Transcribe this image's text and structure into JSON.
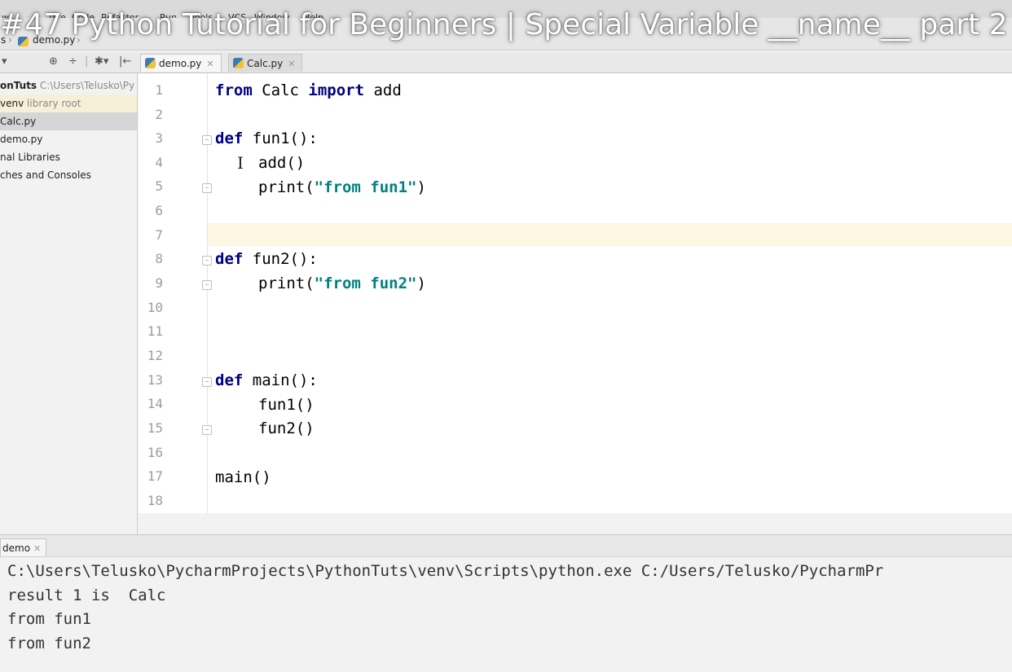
{
  "video_title": "#47 Python Tutorial for Beginners | Special Variable __name__ part 2",
  "menubar": {
    "items": [
      "w",
      "late",
      "Code",
      "Refactor",
      "Run",
      "Tools",
      "VCS",
      "Window",
      "Help"
    ]
  },
  "breadcrumb": {
    "folder": "s",
    "file": "demo.py"
  },
  "toolbar_glyphs": [
    "▾",
    "⊕",
    "÷",
    "|",
    "✱▾",
    "|←"
  ],
  "tabs": [
    {
      "label": "demo.py",
      "active": true
    },
    {
      "label": "Calc.py",
      "active": false
    }
  ],
  "tree": {
    "root_name": "onTuts",
    "root_path": "C:\\Users\\Telusko\\Py",
    "venv_name": "venv",
    "venv_note": "library root",
    "file1": "Calc.py",
    "file2": "demo.py",
    "libs": "nal Libraries",
    "scratches": "ches and Consoles"
  },
  "editor": {
    "current_line": 7,
    "line_numbers": [
      "1",
      "2",
      "3",
      "4",
      "5",
      "6",
      "7",
      "8",
      "9",
      "10",
      "11",
      "12",
      "13",
      "14",
      "15",
      "16",
      "17",
      "18"
    ]
  },
  "code": {
    "l1": {
      "kw1": "from",
      "mid": " Calc ",
      "kw2": "import",
      "rest": " add"
    },
    "l3": {
      "kw": "def",
      "rest": " fun1():"
    },
    "l4": {
      "text": "add()"
    },
    "l5": {
      "pre": "print(",
      "str": "\"from fun1\"",
      "post": ")"
    },
    "l8": {
      "kw": "def",
      "rest": " fun2():"
    },
    "l9": {
      "pre": "print(",
      "str": "\"from fun2\"",
      "post": ")"
    },
    "l13": {
      "kw": "def",
      "rest": " main():"
    },
    "l14": {
      "text": "fun1()"
    },
    "l15": {
      "text": "fun2()"
    },
    "l17": {
      "text": "main()"
    }
  },
  "run": {
    "tab_label": "demo",
    "output": [
      "C:\\Users\\Telusko\\PycharmProjects\\PythonTuts\\venv\\Scripts\\python.exe C:/Users/Telusko/PycharmPr",
      "result 1 is  Calc",
      "from fun1",
      "from fun2"
    ]
  }
}
